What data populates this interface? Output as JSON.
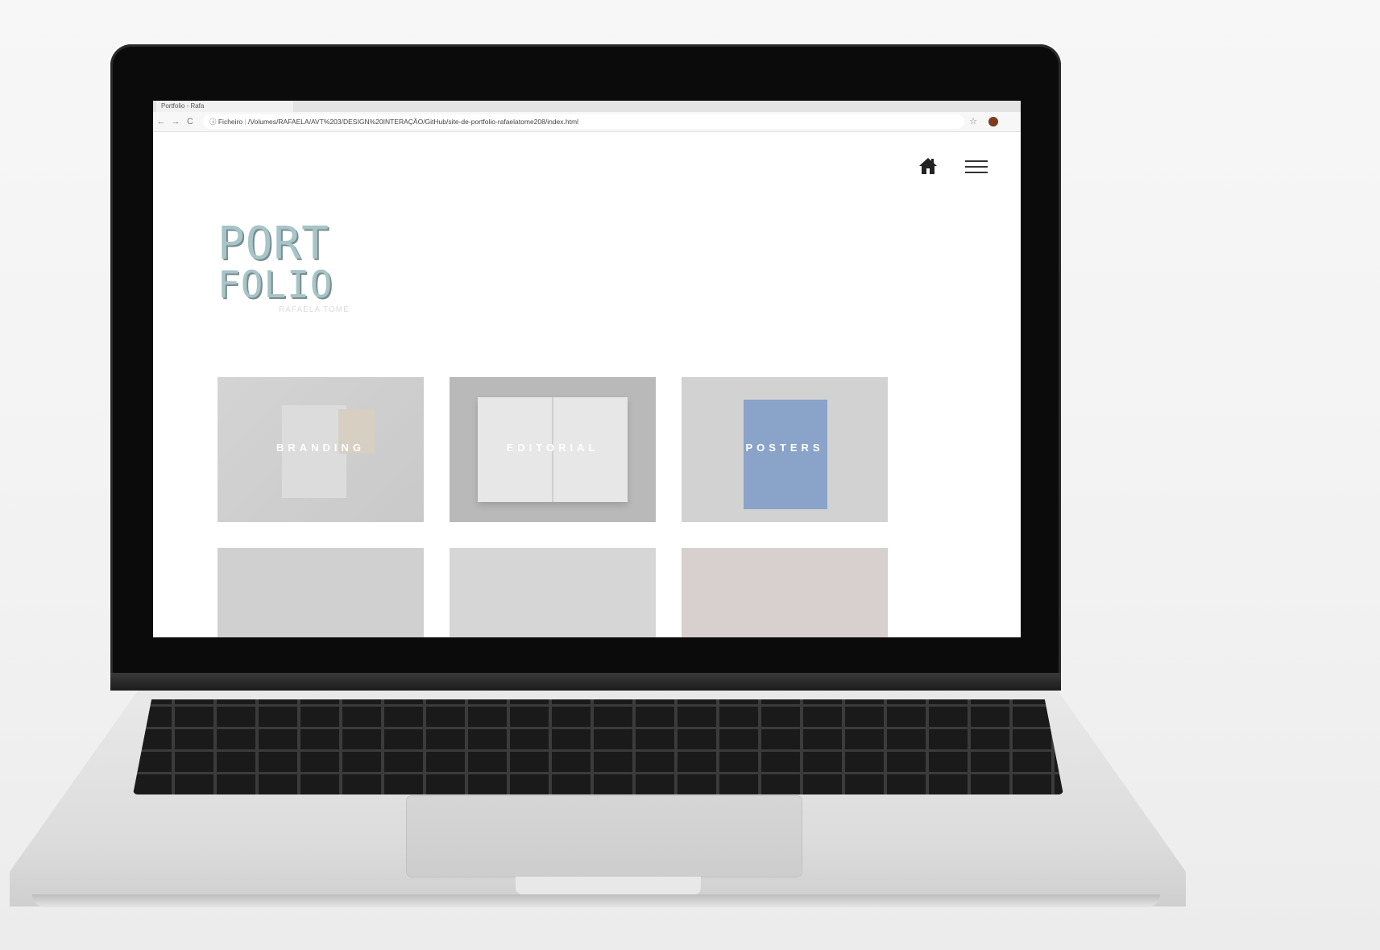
{
  "browser": {
    "tab_title": "Portfolio - Rafa",
    "nav_back": "←",
    "nav_forward": "→",
    "nav_reload": "C",
    "url_prefix": "ⓘ Ficheiro",
    "url": "/Volumes/RAFAELA/AVT%203/DESIGN%20INTERAÇÃO/GitHub/site-de-portfolio-rafaelatome208/index.html",
    "star_icon": "☆"
  },
  "page": {
    "home_icon": "home-icon",
    "menu_icon": "hamburger-menu-icon",
    "title_line1": "PORT",
    "title_line2": "FOLIO",
    "subtitle": "RAFAELA TOMÉ",
    "tiles": [
      {
        "label": "BRANDING"
      },
      {
        "label": "EDITORIAL"
      },
      {
        "label": "POSTERS"
      },
      {
        "label": ""
      },
      {
        "label": ""
      },
      {
        "label": ""
      }
    ]
  },
  "colors": {
    "title": "#a7c4c8",
    "bezel": "#0b0b0b",
    "poster": "#8aa3c9"
  }
}
